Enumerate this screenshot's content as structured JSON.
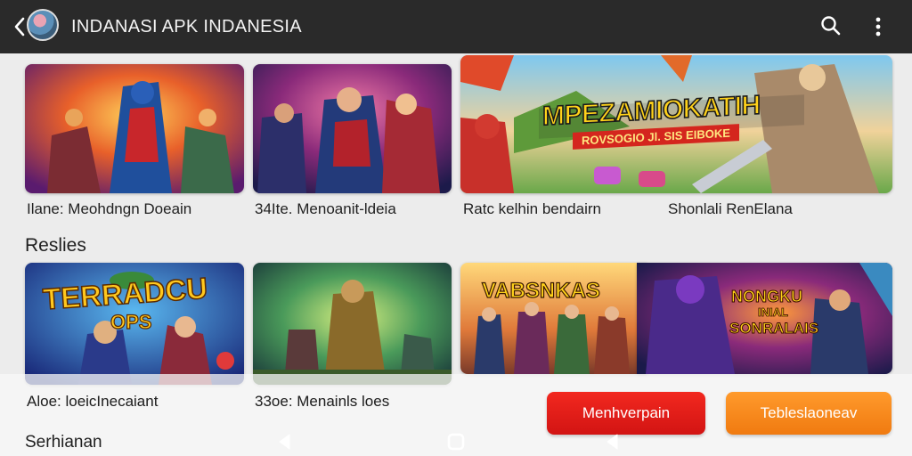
{
  "app_bar": {
    "title": "INDANASI APK INDANESIA",
    "back_icon": "back-arrow-icon",
    "search_icon": "search-icon",
    "more_icon": "more-vertical-icon"
  },
  "featured": {
    "cards": [
      {
        "caption": "Ilane: Meohdngn Doeain"
      },
      {
        "caption": "34Ite. Menoanit-ldeia"
      },
      {
        "caption": "Ratc kelhin bendairn",
        "banner_title": "MPEZAMIOKATIH",
        "banner_subtitle": "ROVSOGIO Jl. SIS EIBOKE"
      },
      {
        "caption": "Shonlali RenElana"
      }
    ]
  },
  "section": {
    "label": "Reslies"
  },
  "results": {
    "cards": [
      {
        "caption": "Aloe: loeicInecaiant",
        "art_title_1": "TERRADCU",
        "art_title_2": "OPS"
      },
      {
        "caption": "33oe: Menainls loes"
      },
      {
        "caption": "",
        "art_title": "VABSNKAS"
      },
      {
        "caption": "",
        "art_title_1": "NONGKU",
        "art_title_2": "INIAL",
        "art_title_3": "SONRALAIS"
      }
    ]
  },
  "footer": {
    "label": "Serhianan",
    "primary_button": "Menhverpain",
    "secondary_button": "Tebleslaoneav"
  },
  "colors": {
    "app_bar": "#2a2a2a",
    "background": "#ececec",
    "primary_button": "#e81e17",
    "secondary_button": "#f7891c"
  }
}
